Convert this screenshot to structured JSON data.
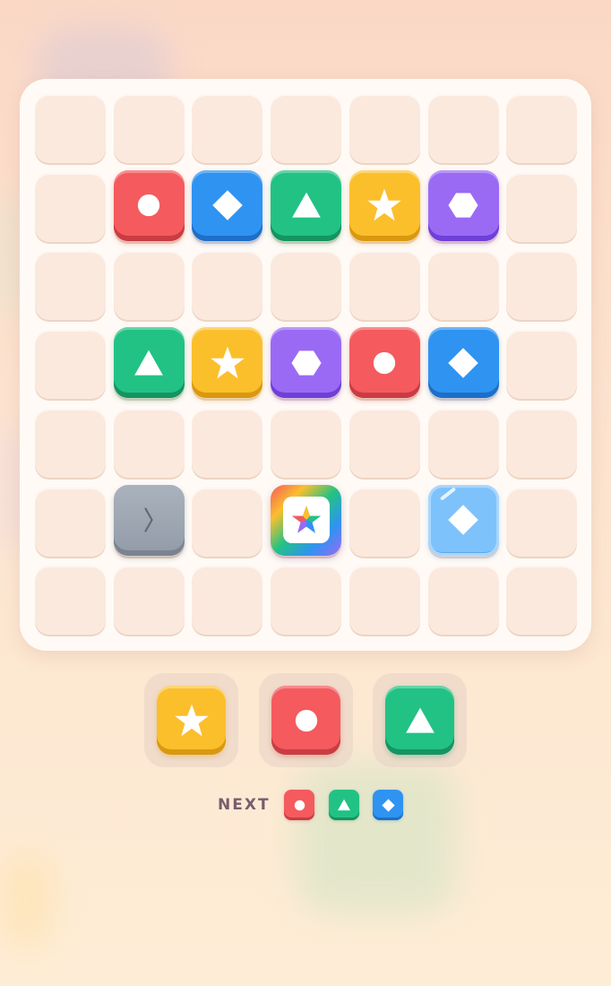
{
  "board": {
    "rows": 7,
    "cols": 7,
    "pieces": [
      {
        "row": 1,
        "col": 1,
        "color": "red",
        "shape": "circle"
      },
      {
        "row": 1,
        "col": 2,
        "color": "blue",
        "shape": "diamond"
      },
      {
        "row": 1,
        "col": 3,
        "color": "green",
        "shape": "triangle"
      },
      {
        "row": 1,
        "col": 4,
        "color": "yellow",
        "shape": "star"
      },
      {
        "row": 1,
        "col": 5,
        "color": "purple",
        "shape": "hexagon"
      },
      {
        "row": 3,
        "col": 1,
        "color": "green",
        "shape": "triangle"
      },
      {
        "row": 3,
        "col": 2,
        "color": "yellow",
        "shape": "star"
      },
      {
        "row": 3,
        "col": 3,
        "color": "purple",
        "shape": "hexagon"
      },
      {
        "row": 3,
        "col": 4,
        "color": "red",
        "shape": "circle"
      },
      {
        "row": 3,
        "col": 5,
        "color": "blue",
        "shape": "diamond"
      },
      {
        "row": 5,
        "col": 1,
        "color": "stone",
        "shape": "chevron"
      },
      {
        "row": 5,
        "col": 3,
        "color": "rainbow",
        "shape": "rainbow-star"
      },
      {
        "row": 5,
        "col": 5,
        "color": "ice",
        "shape": "diamond"
      }
    ]
  },
  "tray": [
    {
      "color": "yellow",
      "shape": "star"
    },
    {
      "color": "red",
      "shape": "circle"
    },
    {
      "color": "green",
      "shape": "triangle"
    }
  ],
  "next": {
    "label": "NEXT",
    "pieces": [
      {
        "color": "red",
        "shape": "circle"
      },
      {
        "color": "green",
        "shape": "triangle"
      },
      {
        "color": "blue",
        "shape": "diamond"
      }
    ]
  },
  "colors": {
    "red": "#f45a5e",
    "blue": "#2f93f1",
    "green": "#22c284",
    "yellow": "#fbbf2c",
    "purple": "#9a6af5",
    "stone": "#9aa3ae",
    "ice": "#7ec2fb",
    "board": "#fffaf5",
    "cell": "#fbe9de"
  }
}
